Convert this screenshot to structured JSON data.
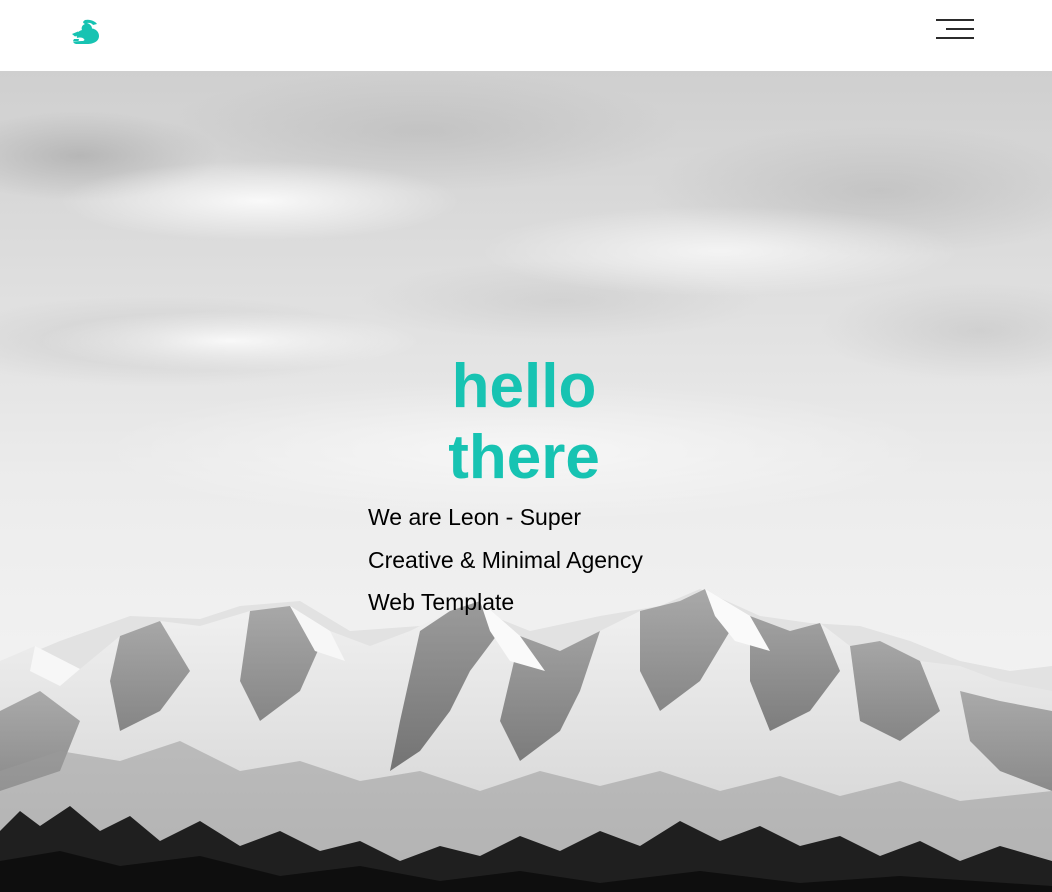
{
  "header": {
    "logo_icon": "dragon-logo-icon",
    "menu_icon": "hamburger-menu-icon",
    "accent_color": "#17c3b2"
  },
  "hero": {
    "background": "snowy-mountains-black-and-white-photo",
    "title_line1": "hello",
    "title_line2": "there",
    "subtitle": "We are Leon - Super Creative & Minimal Agency Web Template",
    "title_color": "#17c3b2",
    "subtitle_color": "#000000"
  }
}
